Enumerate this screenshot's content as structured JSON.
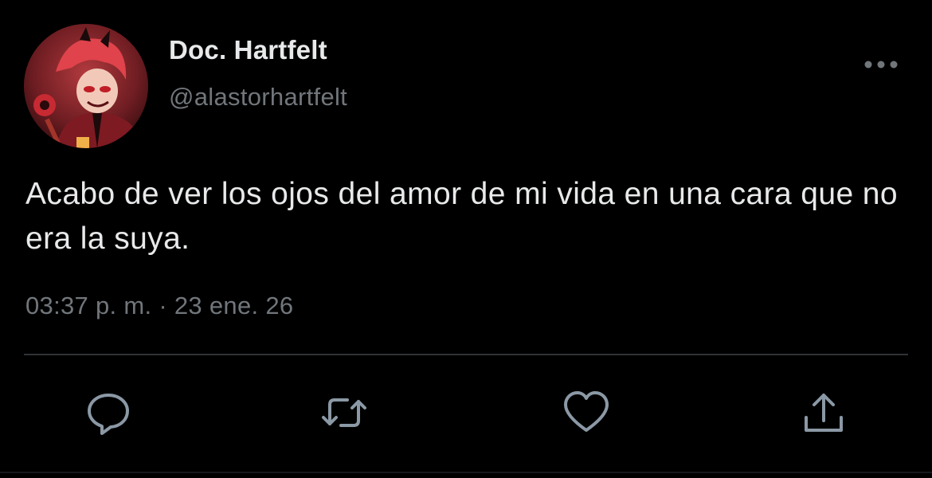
{
  "tweet": {
    "author": {
      "display_name": "Doc. Hartfelt",
      "handle": "@alastorhartfelt",
      "avatar_icon": "avatar-illustration-red-hair"
    },
    "text": "Acabo de ver los ojos del amor de mi vida en una cara que no era la suya.",
    "time": "03:37 p. m.",
    "separator": "·",
    "date": "23 ene. 26",
    "more_icon": "more-horizontal-icon"
  },
  "actions": [
    {
      "name": "reply",
      "icon": "reply-icon"
    },
    {
      "name": "retweet",
      "icon": "retweet-icon"
    },
    {
      "name": "like",
      "icon": "heart-icon"
    },
    {
      "name": "share",
      "icon": "share-icon"
    }
  ],
  "colors": {
    "background": "#000000",
    "primary_text": "#e7e9ea",
    "secondary_text": "#71767b",
    "divider": "#2f3336",
    "icon": "#8b98a5"
  }
}
